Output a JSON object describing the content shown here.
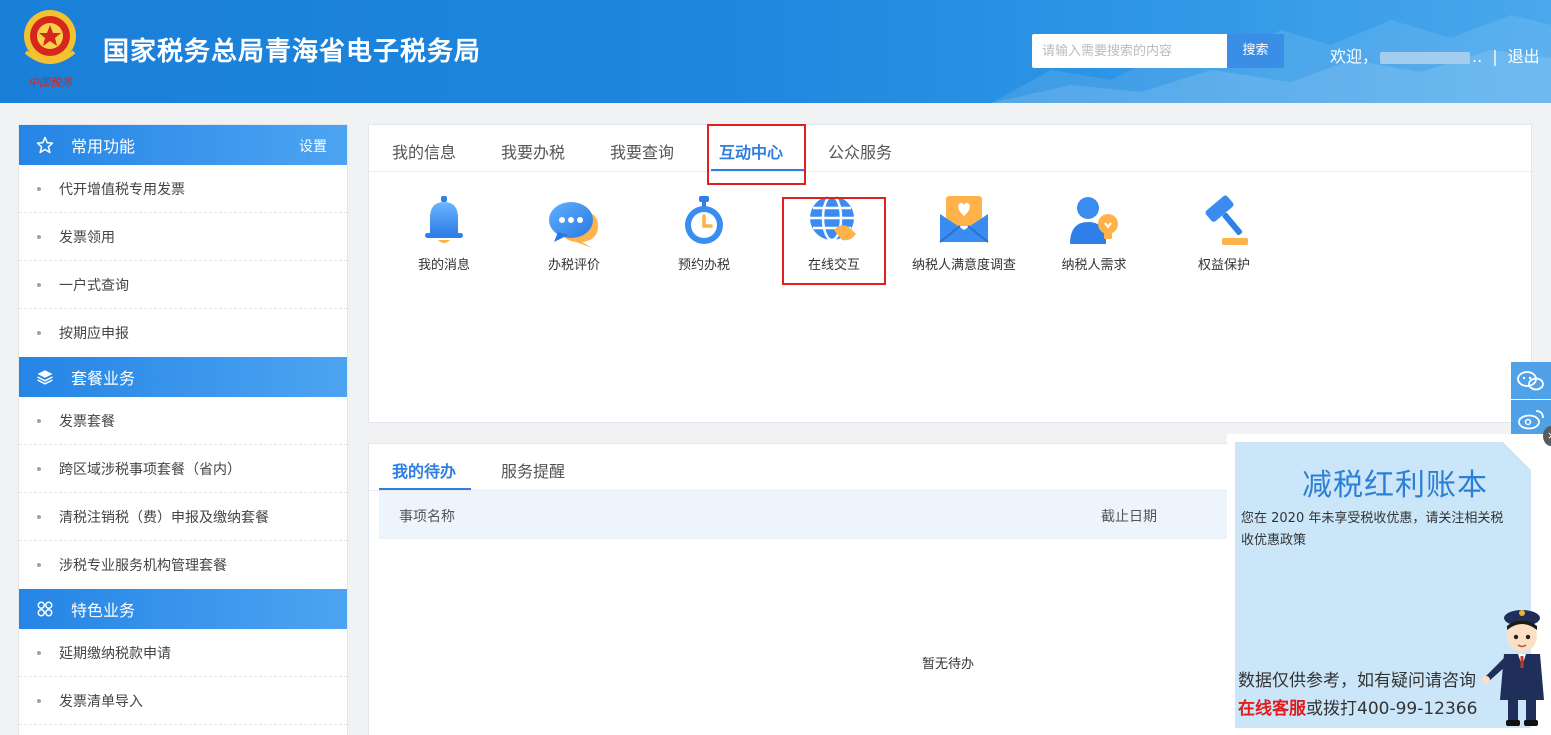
{
  "header": {
    "title": "国家税务总局青海省电子税务局",
    "search_placeholder": "请输入需要搜索的内容",
    "search_button": "搜索",
    "welcome": "欢迎，",
    "welcome_trail": "..",
    "separator": "|",
    "logout": "退出"
  },
  "sidebar": {
    "sections": [
      {
        "title": "常用功能",
        "icon": "star-icon",
        "setting": "设置",
        "items": [
          "代开增值税专用发票",
          "发票领用",
          "一户式查询",
          "按期应申报"
        ]
      },
      {
        "title": "套餐业务",
        "icon": "layers-icon",
        "items": [
          "发票套餐",
          "跨区域涉税事项套餐（省内）",
          "清税注销税（费）申报及缴纳套餐",
          "涉税专业服务机构管理套餐"
        ]
      },
      {
        "title": "特色业务",
        "icon": "grid-icon",
        "items": [
          "延期缴纳税款申请",
          "发票清单导入"
        ]
      }
    ]
  },
  "top_panel": {
    "tabs": [
      "我的信息",
      "我要办税",
      "我要查询",
      "互动中心",
      "公众服务"
    ],
    "active_tab": "互动中心",
    "features": [
      {
        "label": "我的消息",
        "icon": "bell-icon"
      },
      {
        "label": "办税评价",
        "icon": "chat-bubble-icon"
      },
      {
        "label": "预约办税",
        "icon": "stopwatch-icon"
      },
      {
        "label": "在线交互",
        "icon": "globe-handshake-icon"
      },
      {
        "label": "纳税人满意度调查",
        "icon": "envelope-heart-icon"
      },
      {
        "label": "纳税人需求",
        "icon": "user-lightbulb-icon"
      },
      {
        "label": "权益保护",
        "icon": "gavel-icon"
      }
    ]
  },
  "bottom_panel": {
    "tabs": [
      "我的待办",
      "服务提醒"
    ],
    "active_tab": "我的待办",
    "columns": [
      "事项名称",
      "截止日期"
    ],
    "empty_text": "暂无待办"
  },
  "popup": {
    "title": "减税红利账本",
    "note": "您在 2020 年未享受税收优惠，请关注相关税收优惠政策",
    "footer_line1": "数据仅供参考，如有疑问请咨询",
    "footer_link": "在线客服",
    "footer_line2": "或拨打400-99-12366",
    "close": "×"
  },
  "floating_buttons": [
    "wechat-icon",
    "weibo-icon"
  ],
  "colors": {
    "brand_blue": "#1d86de",
    "accent_blue": "#2e7ee0",
    "highlight_red": "#e02020"
  }
}
